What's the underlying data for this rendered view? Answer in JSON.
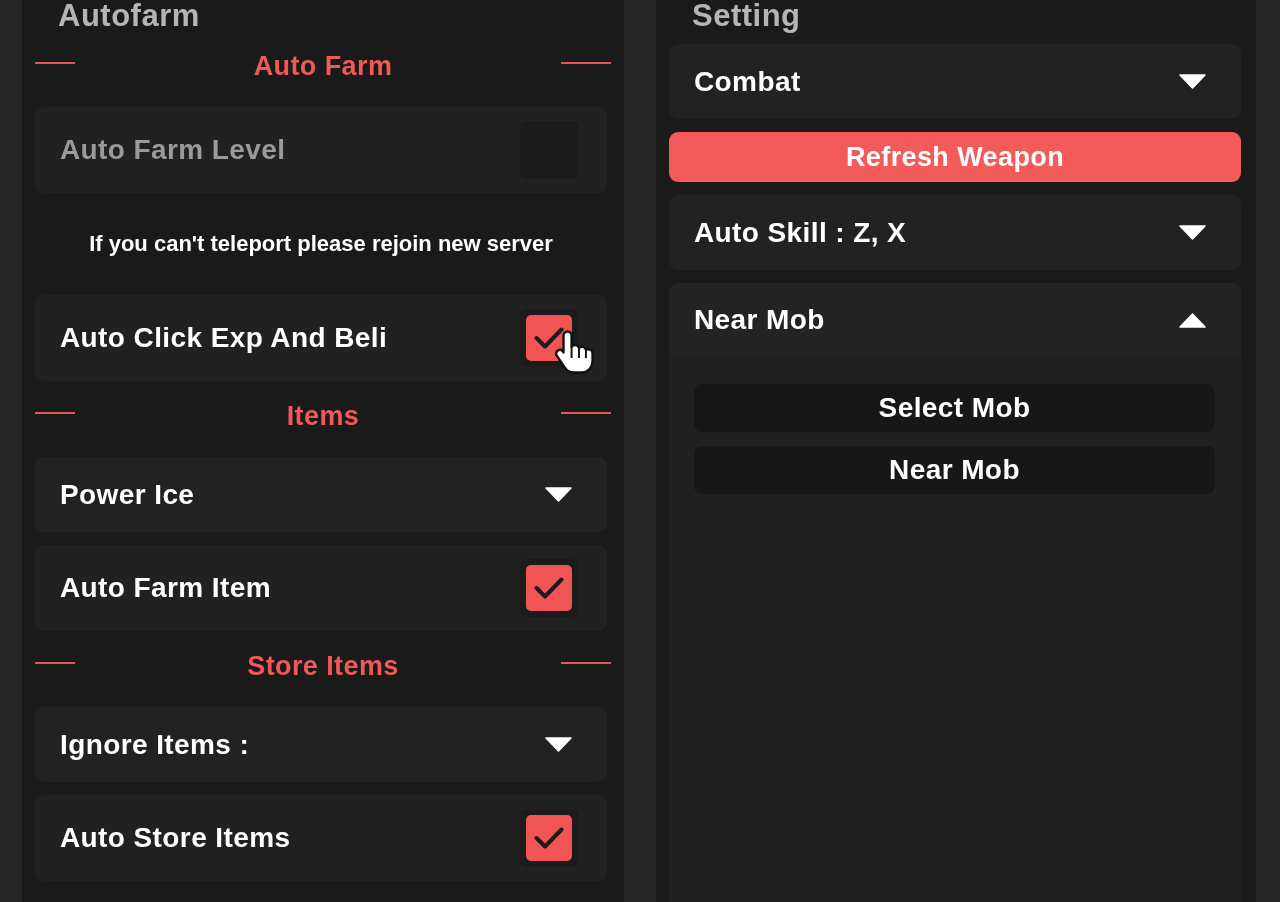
{
  "panels": [
    {
      "title": "Autofarm",
      "items": [
        {
          "kind": "section",
          "label": "Auto Farm"
        },
        {
          "kind": "toggle",
          "label": "Auto Farm Level",
          "checked": false,
          "disabled": true,
          "hovered": false
        },
        {
          "kind": "note",
          "label": "If you can't teleport please rejoin new server"
        },
        {
          "kind": "toggle",
          "label": "Auto Click Exp And Beli",
          "checked": true,
          "disabled": false,
          "hovered": true
        },
        {
          "kind": "section",
          "label": "Items"
        },
        {
          "kind": "dropdown",
          "label": "Power Ice",
          "expanded": false
        },
        {
          "kind": "toggle",
          "label": "Auto Farm Item",
          "checked": true,
          "disabled": false,
          "hovered": false
        },
        {
          "kind": "section",
          "label": "Store Items"
        },
        {
          "kind": "dropdown",
          "label": "Ignore Items :",
          "expanded": false
        },
        {
          "kind": "toggle",
          "label": "Auto Store Items",
          "checked": true,
          "disabled": false,
          "hovered": false
        }
      ]
    },
    {
      "title": "Setting",
      "items": [
        {
          "kind": "dropdown",
          "label": "Combat",
          "expanded": false
        },
        {
          "kind": "button",
          "label": "Refresh Weapon"
        },
        {
          "kind": "dropdown",
          "label": "Auto Skill : Z, X",
          "expanded": false
        },
        {
          "kind": "dropdown",
          "label": "Near Mob",
          "expanded": true,
          "options": [
            "Select Mob",
            "Near Mob"
          ]
        }
      ]
    }
  ]
}
